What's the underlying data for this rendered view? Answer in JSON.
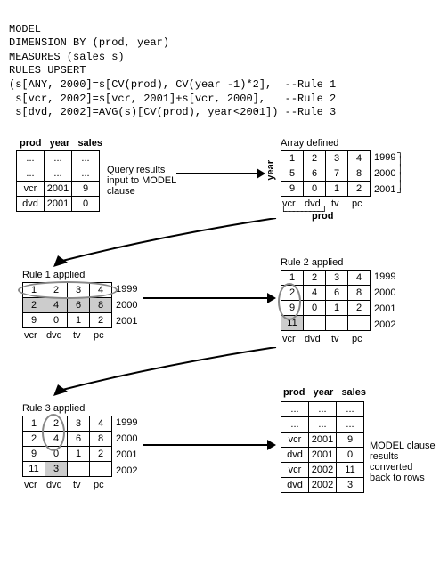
{
  "code": {
    "line1": "MODEL",
    "line2": "DIMENSION BY (prod, year)",
    "line3": "MEASURES (sales s)",
    "line4": "RULES UPSERT",
    "line5": "(s[ANY, 2000]=s[CV(prod), CV(year -1)*2],  --Rule 1",
    "line6": " s[vcr, 2002]=s[vcr, 2001]+s[vcr, 2000],   --Rule 2",
    "line7": " s[dvd, 2002]=AVG(s)[CV(prod), year<2001]) --Rule 3"
  },
  "headers": {
    "prod": "prod",
    "year": "year",
    "sales": "sales"
  },
  "input_table": {
    "row1": {
      "prod": "...",
      "year": "...",
      "sales": "..."
    },
    "row2": {
      "prod": "...",
      "year": "...",
      "sales": "..."
    },
    "row3": {
      "prod": "vcr",
      "year": "2001",
      "sales": "9"
    },
    "row4": {
      "prod": "dvd",
      "year": "2001",
      "sales": "0"
    }
  },
  "input_caption": "Query results\ninput to MODEL\nclause",
  "array_defined": {
    "title": "Array defined",
    "data": [
      [
        "1",
        "2",
        "3",
        "4"
      ],
      [
        "5",
        "6",
        "7",
        "8"
      ],
      [
        "9",
        "0",
        "1",
        "2"
      ]
    ],
    "years": [
      "1999",
      "2000",
      "2001"
    ],
    "prods": [
      "vcr",
      "dvd",
      "tv",
      "pc"
    ],
    "row_axis": "year",
    "col_axis": "prod"
  },
  "rule1": {
    "title": "Rule 1 applied",
    "data": [
      [
        "1",
        "2",
        "3",
        "4"
      ],
      [
        "2",
        "4",
        "6",
        "8"
      ],
      [
        "9",
        "0",
        "1",
        "2"
      ]
    ],
    "years": [
      "1999",
      "2000",
      "2001"
    ],
    "prods": [
      "vcr",
      "dvd",
      "tv",
      "pc"
    ]
  },
  "rule2": {
    "title": "Rule 2 applied",
    "data": [
      [
        "1",
        "2",
        "3",
        "4"
      ],
      [
        "2",
        "4",
        "6",
        "8"
      ],
      [
        "9",
        "0",
        "1",
        "2"
      ],
      [
        "11",
        "",
        "",
        ""
      ]
    ],
    "years": [
      "1999",
      "2000",
      "2001",
      "2002"
    ],
    "prods": [
      "vcr",
      "dvd",
      "tv",
      "pc"
    ]
  },
  "rule3": {
    "title": "Rule 3 applied",
    "data": [
      [
        "1",
        "2",
        "3",
        "4"
      ],
      [
        "2",
        "4",
        "6",
        "8"
      ],
      [
        "9",
        "0",
        "1",
        "2"
      ],
      [
        "11",
        "3",
        "",
        ""
      ]
    ],
    "years": [
      "1999",
      "2000",
      "2001",
      "2002"
    ],
    "prods": [
      "vcr",
      "dvd",
      "tv",
      "pc"
    ]
  },
  "output_table": {
    "row1": {
      "prod": "...",
      "year": "...",
      "sales": "..."
    },
    "row2": {
      "prod": "...",
      "year": "...",
      "sales": "..."
    },
    "row3": {
      "prod": "vcr",
      "year": "2001",
      "sales": "9"
    },
    "row4": {
      "prod": "dvd",
      "year": "2001",
      "sales": "0"
    },
    "row5": {
      "prod": "vcr",
      "year": "2002",
      "sales": "11"
    },
    "row6": {
      "prod": "dvd",
      "year": "2002",
      "sales": "3"
    }
  },
  "output_caption": "MODEL clause\nresults\nconverted\nback to rows",
  "chart_data": {
    "type": "table",
    "description": "SQL MODEL clause transformation diagram showing rule application on a 2D sales array indexed by product and year",
    "input_rows": [
      {
        "prod": "vcr",
        "year": 2001,
        "sales": 9
      },
      {
        "prod": "dvd",
        "year": 2001,
        "sales": 0
      }
    ],
    "array_initial": {
      "years": [
        1999,
        2000,
        2001
      ],
      "prods": [
        "vcr",
        "dvd",
        "tv",
        "pc"
      ],
      "values": [
        [
          1,
          2,
          3,
          4
        ],
        [
          5,
          6,
          7,
          8
        ],
        [
          9,
          0,
          1,
          2
        ]
      ]
    },
    "after_rule1": {
      "years": [
        1999,
        2000,
        2001
      ],
      "values": [
        [
          1,
          2,
          3,
          4
        ],
        [
          2,
          4,
          6,
          8
        ],
        [
          9,
          0,
          1,
          2
        ]
      ]
    },
    "after_rule2": {
      "years": [
        1999,
        2000,
        2001,
        2002
      ],
      "values": [
        [
          1,
          2,
          3,
          4
        ],
        [
          2,
          4,
          6,
          8
        ],
        [
          9,
          0,
          1,
          2
        ],
        [
          11,
          null,
          null,
          null
        ]
      ]
    },
    "after_rule3": {
      "years": [
        1999,
        2000,
        2001,
        2002
      ],
      "values": [
        [
          1,
          2,
          3,
          4
        ],
        [
          2,
          4,
          6,
          8
        ],
        [
          9,
          0,
          1,
          2
        ],
        [
          11,
          3,
          null,
          null
        ]
      ]
    },
    "output_rows": [
      {
        "prod": "vcr",
        "year": 2001,
        "sales": 9
      },
      {
        "prod": "dvd",
        "year": 2001,
        "sales": 0
      },
      {
        "prod": "vcr",
        "year": 2002,
        "sales": 11
      },
      {
        "prod": "dvd",
        "year": 2002,
        "sales": 3
      }
    ]
  }
}
